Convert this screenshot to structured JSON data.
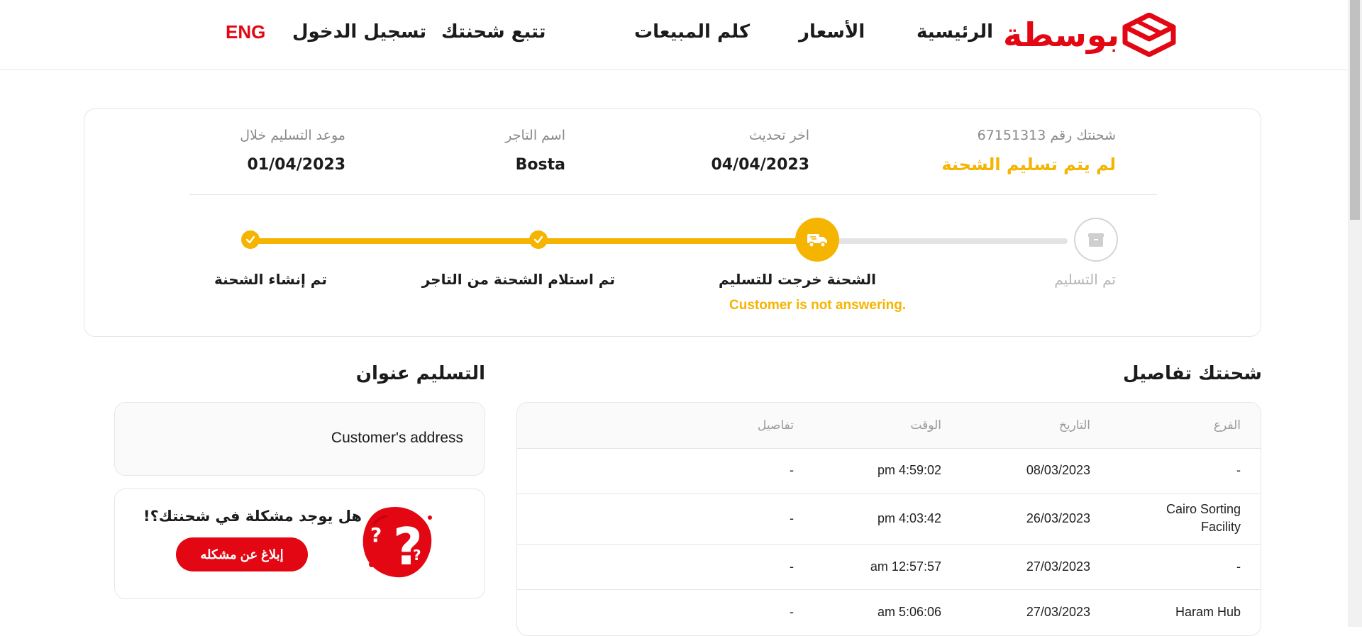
{
  "brand": {
    "name": "بوسطة",
    "color": "#e30613",
    "accent": "#f4b400"
  },
  "nav": {
    "home": "الرئيسية",
    "prices": "الأسعار",
    "sales": "كلم المبيعات",
    "track": "تتبع شحنتك",
    "login": "تسجيل الدخول",
    "lang": "ENG"
  },
  "shipment": {
    "number_label": "شحنتك رقم 67151313",
    "status": "لم يتم تسليم الشحنة",
    "last_update_label": "اخر تحديث",
    "last_update_value": "04/04/2023",
    "merchant_label": "اسم التاجر",
    "merchant_value": "Bosta",
    "delivery_label": "موعد التسليم خلال",
    "delivery_value": "01/04/2023"
  },
  "progress": {
    "fraction_complete": 0.69,
    "steps": [
      {
        "label": "تم التسليم",
        "state": "pending",
        "icon": "box-icon"
      },
      {
        "label": "الشحنة خرجت للتسليم",
        "state": "current",
        "icon": "truck-icon",
        "note": "Customer is not answering."
      },
      {
        "label": "تم استلام الشحنة من التاجر",
        "state": "done",
        "icon": "check-icon"
      },
      {
        "label": "تم إنشاء الشحنة",
        "state": "done",
        "icon": "check-icon"
      }
    ]
  },
  "details": {
    "title": "شحنتك تفاصيل",
    "columns": [
      "الفرع",
      "التاريخ",
      "الوقت",
      "تفاصيل"
    ],
    "rows": [
      {
        "branch": "-",
        "branch2": "",
        "date": "08/03/2023",
        "time": "pm 4:59:02",
        "details": "-"
      },
      {
        "branch": "Cairo Sorting",
        "branch2": "Facility",
        "date": "26/03/2023",
        "time": "pm 4:03:42",
        "details": "-"
      },
      {
        "branch": "-",
        "branch2": "",
        "date": "27/03/2023",
        "time": "am 12:57:57",
        "details": "-"
      },
      {
        "branch": "Haram Hub",
        "branch2": "",
        "date": "27/03/2023",
        "time": "am 5:06:06",
        "details": "-"
      }
    ]
  },
  "address": {
    "title": "التسليم عنوان",
    "value": "Customer's address"
  },
  "problem": {
    "question": "هل يوجد مشكلة في شحنتك؟!",
    "button": "إبلاغ عن مشكله"
  }
}
